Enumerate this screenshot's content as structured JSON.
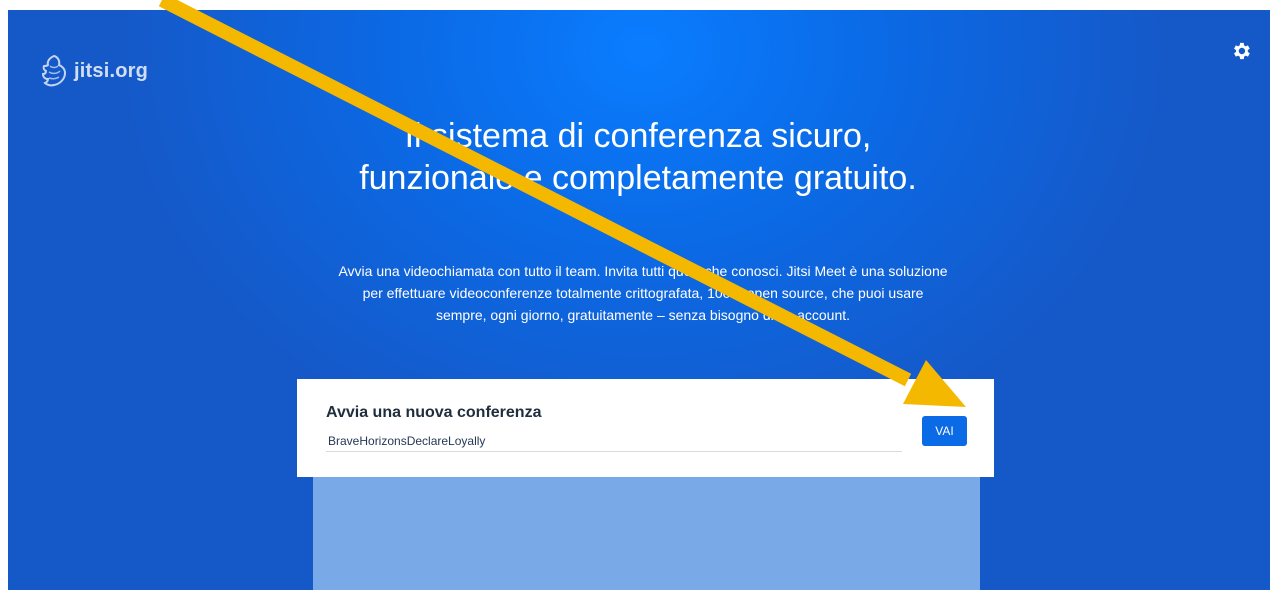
{
  "brand": {
    "logo_text": "jitsi.org",
    "logo_icon": "jitsi-logo-icon"
  },
  "header": {
    "settings_icon": "gear-icon"
  },
  "hero": {
    "title": "Il sistema di conferenza sicuro, funzionale e completamente gratuito.",
    "description": "Avvia una videochiamata con tutto il team. Invita tutti quelli che conosci. Jitsi Meet è una soluzione per effettuare videoconferenze totalmente crittografata, 100% open source, che puoi usare sempre, ogni giorno, gratuitamente – senza bisogno di un account."
  },
  "start_card": {
    "title": "Avvia una nuova conferenza",
    "room_name_value": "BraveHorizonsDeclareLoyally",
    "go_label": "VAI"
  },
  "colors": {
    "hero_blue": "#0b6ae6",
    "button_blue": "#0b6ae6",
    "annotation_arrow": "#f5b800"
  }
}
